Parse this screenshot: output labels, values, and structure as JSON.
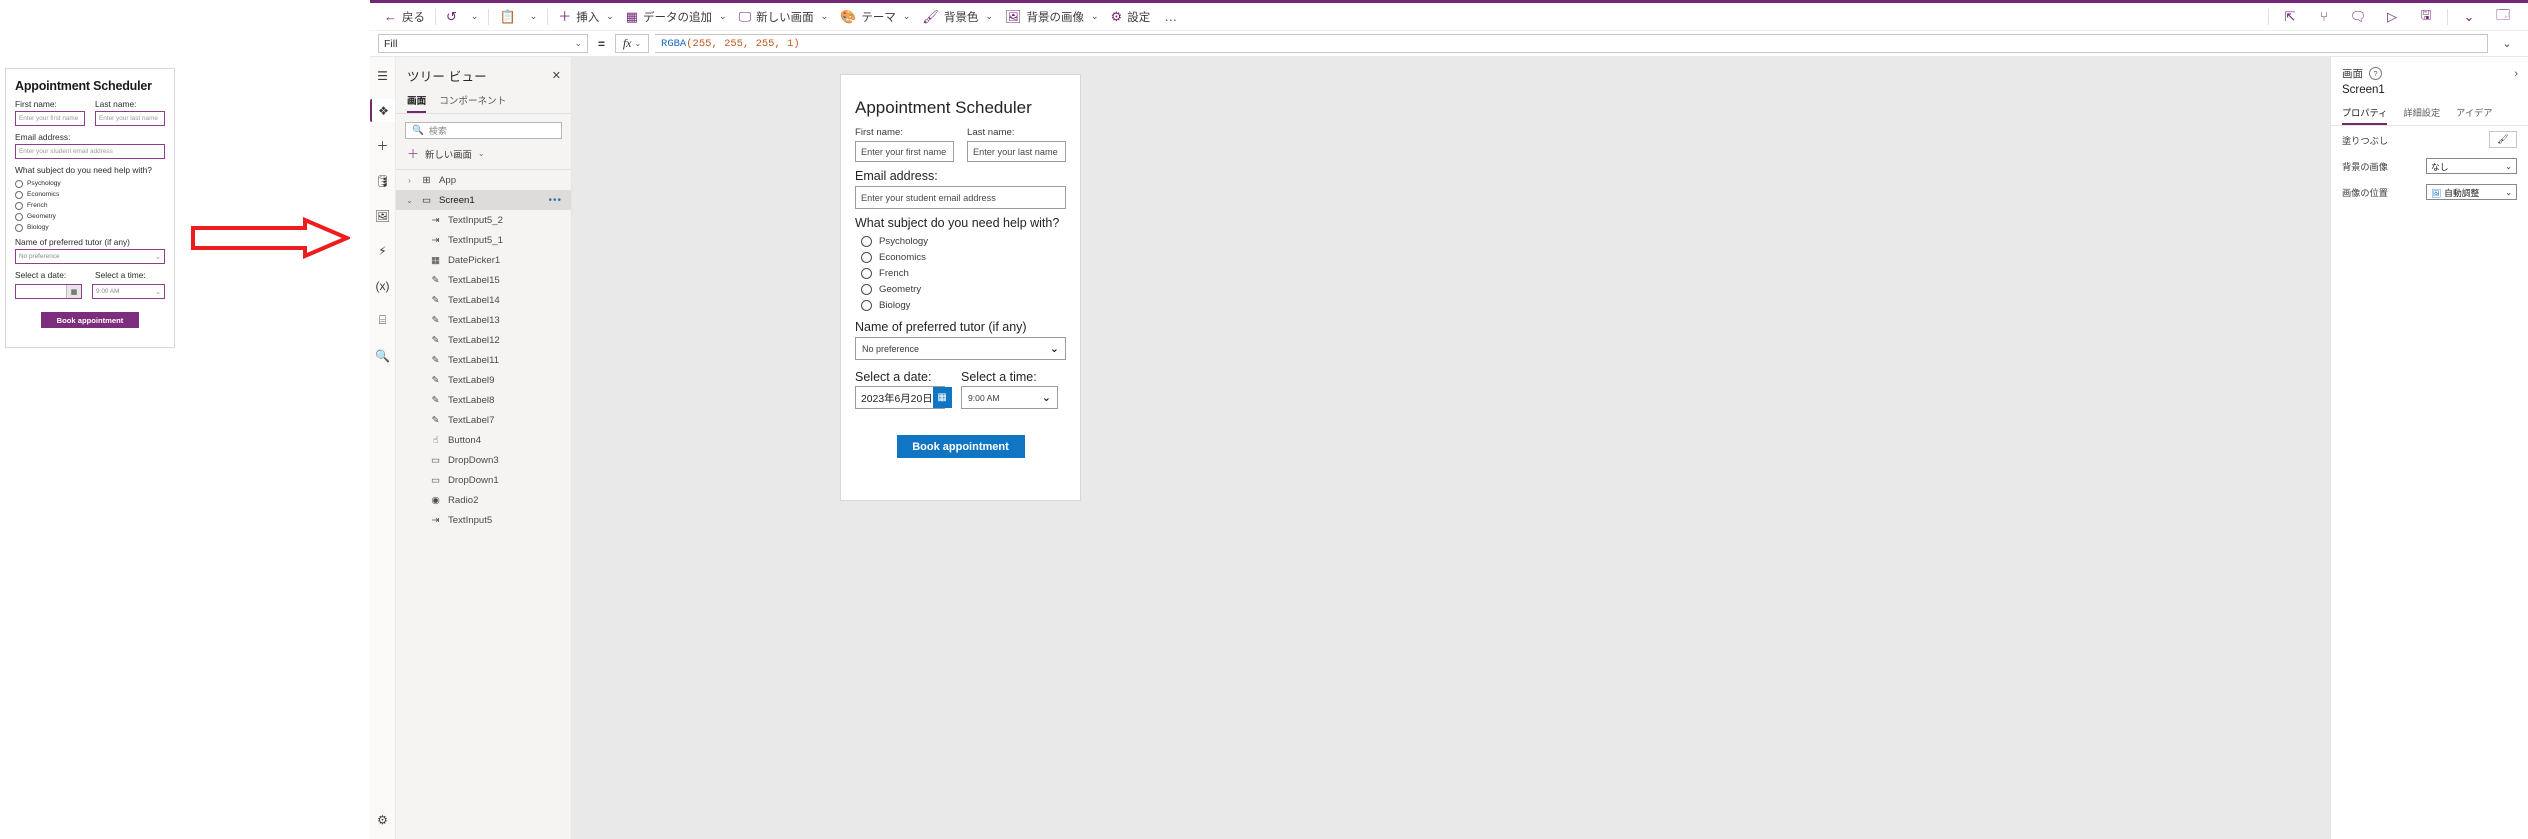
{
  "mock_form": {
    "title": "Appointment Scheduler",
    "first_name_label": "First name:",
    "first_name_placeholder": "Enter your first name",
    "last_name_label": "Last name:",
    "last_name_placeholder": "Enter your last name",
    "email_label": "Email address:",
    "email_placeholder": "Enter your student email address",
    "subject_label": "What subject do you need help with?",
    "subjects": [
      "Psychology",
      "Economics",
      "French",
      "Geometry",
      "Biology"
    ],
    "tutor_label": "Name of preferred tutor (if any)",
    "tutor_value": "No preference",
    "date_label": "Select a date:",
    "date_value": "",
    "time_label": "Select a time:",
    "time_value": "9:00 AM",
    "submit_label": "Book appointment"
  },
  "toolbar": {
    "back": "戻る",
    "undo": "undo-icon",
    "paste": "paste-icon",
    "insert": "挿入",
    "add_data": "データの追加",
    "new_screen": "新しい画面",
    "theme": "テーマ",
    "background_color": "背景色",
    "background_image": "背景の画像",
    "settings": "設定",
    "more": "…",
    "right_icons": [
      "share-icon",
      "flow-icon",
      "comment-icon",
      "play-icon",
      "save-icon",
      "chevron-down-icon",
      "publish-icon"
    ]
  },
  "formula_bar": {
    "property": "Fill",
    "equals": "=",
    "fx": "fx",
    "formula_fn": "RGBA",
    "formula_args": [
      "255",
      "255",
      "255",
      "1"
    ]
  },
  "tree_panel": {
    "title": "ツリー ビュー",
    "close": "✕",
    "tabs": [
      {
        "label": "画面",
        "active": true
      },
      {
        "label": "コンポーネント",
        "active": false
      }
    ],
    "search_placeholder": "検索",
    "new_screen": "新しい画面",
    "app_node": "App",
    "screen_node": "Screen1",
    "items": [
      {
        "label": "TextInput5_2",
        "icon": "text-input-icon"
      },
      {
        "label": "TextInput5_1",
        "icon": "text-input-icon"
      },
      {
        "label": "DatePicker1",
        "icon": "date-picker-icon"
      },
      {
        "label": "TextLabel15",
        "icon": "label-icon"
      },
      {
        "label": "TextLabel14",
        "icon": "label-icon"
      },
      {
        "label": "TextLabel13",
        "icon": "label-icon"
      },
      {
        "label": "TextLabel12",
        "icon": "label-icon"
      },
      {
        "label": "TextLabel11",
        "icon": "label-icon"
      },
      {
        "label": "TextLabel9",
        "icon": "label-icon"
      },
      {
        "label": "TextLabel8",
        "icon": "label-icon"
      },
      {
        "label": "TextLabel7",
        "icon": "label-icon"
      },
      {
        "label": "Button4",
        "icon": "button-icon"
      },
      {
        "label": "DropDown3",
        "icon": "dropdown-icon"
      },
      {
        "label": "DropDown1",
        "icon": "dropdown-icon"
      },
      {
        "label": "Radio2",
        "icon": "radio-icon"
      },
      {
        "label": "TextInput5",
        "icon": "text-input-icon"
      }
    ]
  },
  "canvas_form": {
    "title": "Appointment Scheduler",
    "first_name_label": "First name:",
    "first_name_placeholder": "Enter your first name",
    "last_name_label": "Last name:",
    "last_name_placeholder": "Enter your last name",
    "email_label": "Email address:",
    "email_placeholder": "Enter your student email address",
    "subject_label": "What subject do you need help with?",
    "subjects": [
      "Psychology",
      "Economics",
      "French",
      "Geometry",
      "Biology"
    ],
    "tutor_label": "Name of preferred tutor (if any)",
    "tutor_value": "No preference",
    "date_label": "Select a date:",
    "date_value": "2023年6月20日",
    "time_label": "Select a time:",
    "time_value": "9:00 AM",
    "submit_label": "Book appointment",
    "accent_color": "#1076c4"
  },
  "properties_panel": {
    "kind": "画面",
    "help": "?",
    "expand": "›",
    "name": "Screen1",
    "tabs": [
      {
        "label": "プロパティ",
        "active": true
      },
      {
        "label": "詳細設定",
        "active": false
      },
      {
        "label": "アイデア",
        "active": false
      }
    ],
    "rows": [
      {
        "label": "塗りつぶし",
        "type": "fill",
        "value": ""
      },
      {
        "label": "背景の画像",
        "type": "dropdown",
        "value": "なし"
      },
      {
        "label": "画像の位置",
        "type": "dropdown",
        "value": "自動調整",
        "icon": "image-icon"
      }
    ]
  }
}
